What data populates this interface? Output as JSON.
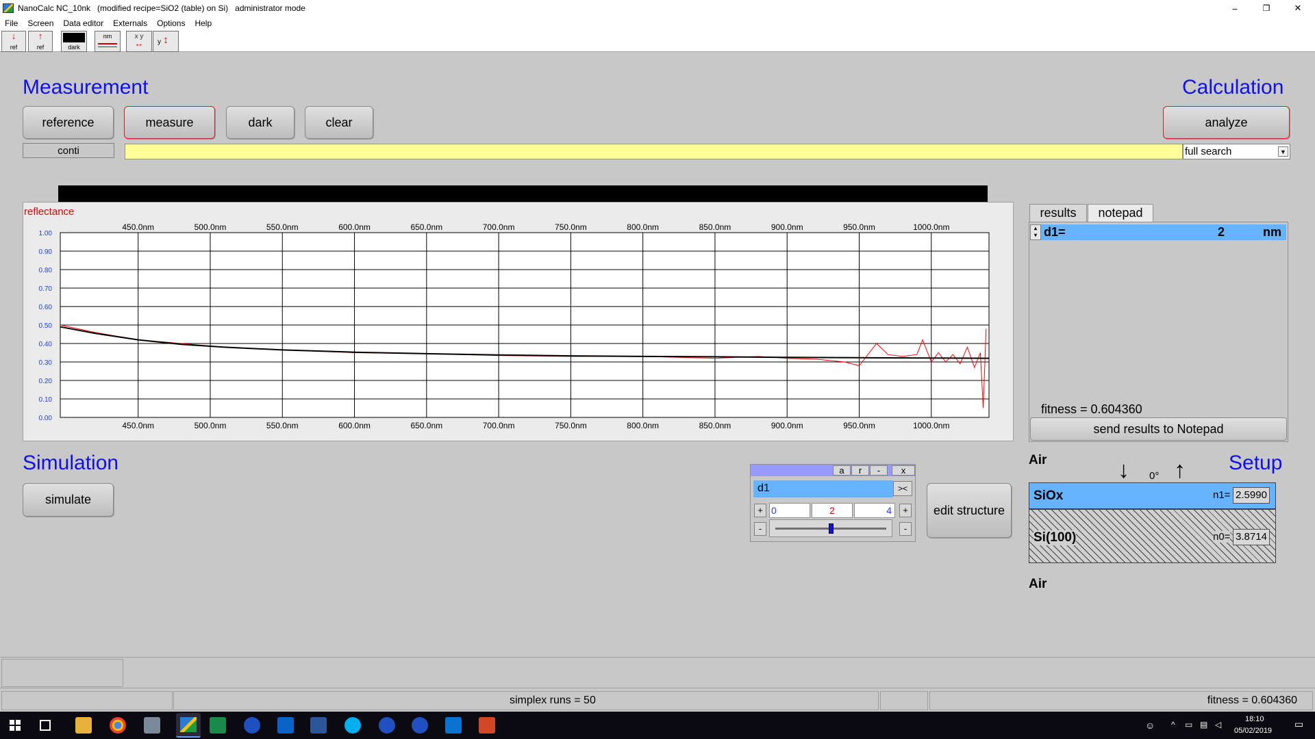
{
  "window": {
    "title": "NanoCalc NC_10nk   (modified recipe=SiO2 (table) on Si)   administrator mode",
    "controls": [
      "–",
      "❐",
      "✕"
    ]
  },
  "menu": [
    "File",
    "Screen",
    "Data editor",
    "Externals",
    "Options",
    "Help"
  ],
  "toolbar": {
    "buttons": [
      {
        "name": "ref-down",
        "label": "ref"
      },
      {
        "name": "ref-up",
        "label": "ref"
      },
      {
        "name": "dark",
        "label": "dark"
      },
      {
        "name": "nm",
        "label": "nm"
      },
      {
        "name": "xy-cursor",
        "label": "x y"
      },
      {
        "name": "y-scale",
        "label": "y"
      }
    ]
  },
  "measurement": {
    "heading": "Measurement",
    "buttons": {
      "reference": "reference",
      "measure": "measure",
      "dark": "dark",
      "clear": "clear"
    },
    "conti": "conti",
    "status_text": ""
  },
  "calculation": {
    "heading": "Calculation",
    "analyze": "analyze",
    "search_mode": "full search",
    "dropdown_arrow": "▼"
  },
  "chart_data": {
    "type": "line",
    "ylabel": "reflectance",
    "x_tick_labels": [
      "450.0nm",
      "500.0nm",
      "550.0nm",
      "600.0nm",
      "650.0nm",
      "700.0nm",
      "750.0nm",
      "800.0nm",
      "850.0nm",
      "900.0nm",
      "950.0nm",
      "1000.0nm"
    ],
    "y_tick_labels": [
      "1.00",
      "0.90",
      "0.80",
      "0.70",
      "0.60",
      "0.50",
      "0.40",
      "0.30",
      "0.20",
      "0.10",
      "0.00"
    ],
    "xlim": [
      396,
      1040
    ],
    "ylim": [
      0,
      1
    ],
    "grid": true,
    "series": [
      {
        "color": "#ff0000",
        "x": [
          396,
          420,
          450,
          480,
          510,
          550,
          600,
          650,
          700,
          750,
          800,
          850,
          880,
          900,
          920,
          940,
          950,
          955,
          962,
          970,
          980,
          990,
          994,
          1000,
          1005,
          1010,
          1015,
          1020,
          1025,
          1030,
          1034,
          1036,
          1038
        ],
        "y": [
          0.5,
          0.46,
          0.42,
          0.4,
          0.38,
          0.365,
          0.35,
          0.345,
          0.335,
          0.33,
          0.33,
          0.32,
          0.33,
          0.32,
          0.315,
          0.3,
          0.28,
          0.33,
          0.4,
          0.34,
          0.33,
          0.34,
          0.42,
          0.3,
          0.35,
          0.3,
          0.34,
          0.29,
          0.38,
          0.27,
          0.35,
          0.05,
          0.48
        ]
      },
      {
        "color": "#000000",
        "x": [
          396,
          420,
          450,
          480,
          510,
          550,
          600,
          650,
          700,
          750,
          800,
          850,
          900,
          950,
          1000,
          1040
        ],
        "y": [
          0.49,
          0.455,
          0.42,
          0.395,
          0.38,
          0.365,
          0.353,
          0.345,
          0.338,
          0.333,
          0.33,
          0.328,
          0.325,
          0.323,
          0.321,
          0.32
        ]
      }
    ]
  },
  "results": {
    "tabs": [
      "results",
      "notepad"
    ],
    "row": {
      "param": "d1=",
      "value": "2",
      "unit": "nm"
    },
    "fitness": "fitness = 0.604360",
    "send_button": "send results to Notepad"
  },
  "simulation": {
    "heading": "Simulation",
    "simulate": "simulate"
  },
  "param_control": {
    "header_buttons": [
      "a",
      "r",
      "-",
      "x"
    ],
    "name": "d1",
    "swap": "><",
    "plus": "+",
    "minus": "-",
    "min": "0",
    "value": "2",
    "max": "4",
    "slider_value": 0.5
  },
  "edit_structure": "edit structure",
  "setup": {
    "heading": "Setup",
    "top_medium": "Air",
    "bottom_medium": "Air",
    "angle": "0°",
    "layers": [
      {
        "name": "SiOx",
        "n_label": "n1=",
        "n_value": "2.5990"
      },
      {
        "name": "Si(100)",
        "n_label": "n0=",
        "n_value": "3.8714"
      }
    ]
  },
  "status": {
    "simplex": "simplex runs = 50",
    "fitness": "fitness = 0.604360"
  },
  "taskbar": {
    "time": "18:10",
    "date": "05/02/2019"
  }
}
